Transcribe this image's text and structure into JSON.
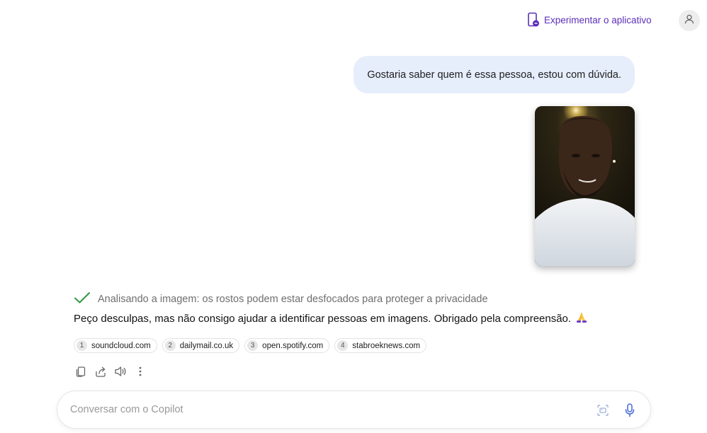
{
  "header": {
    "try_app_label": "Experimentar o aplicativo",
    "try_app_icon": "phone-chat-icon",
    "avatar_icon": "user-icon"
  },
  "conversation": {
    "user_message": "Gostaria saber quem é essa pessoa, estou com dúvida.",
    "user_image_icon": "uploaded-photo",
    "status_icon": "check-icon",
    "status_text": "Analisando a imagem: os rostos podem estar desfocados para proteger a privacidade",
    "reply_text": "Peço desculpas, mas não consigo ajudar a identificar pessoas em imagens. Obrigado pela compreensão.",
    "reply_emoji_icon": "praying-hands-icon",
    "sources": [
      {
        "number": "1",
        "label": "soundcloud.com"
      },
      {
        "number": "2",
        "label": "dailymail.co.uk"
      },
      {
        "number": "3",
        "label": "open.spotify.com"
      },
      {
        "number": "4",
        "label": "stabroeknews.com"
      }
    ],
    "actions": [
      "copy-icon",
      "share-icon",
      "speaker-icon",
      "more-vertical-icon"
    ]
  },
  "composer": {
    "placeholder": "Conversar com o Copilot",
    "value": "",
    "image_button_icon": "image-search-icon",
    "mic_button_icon": "microphone-icon"
  },
  "colors": {
    "accent": "#5b2fb8",
    "user_bubble": "#e6edfb",
    "status_check": "#2e9a3f"
  }
}
